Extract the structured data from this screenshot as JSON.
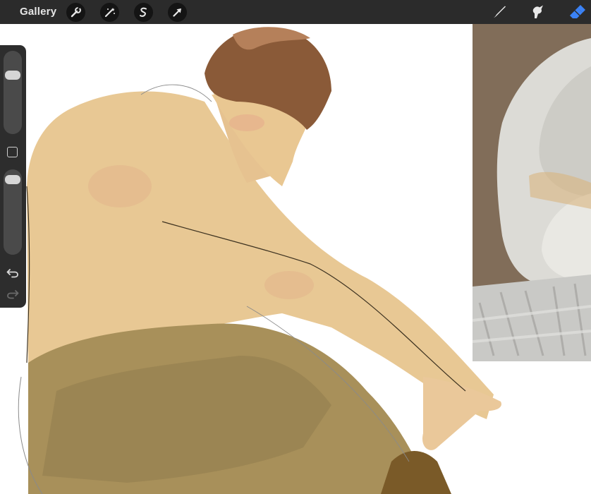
{
  "toolbar": {
    "gallery_label": "Gallery",
    "left_tools": [
      "wrench-icon",
      "magic-wand-icon",
      "selection-icon",
      "transform-arrow-icon"
    ],
    "right_tools": [
      "brush-icon",
      "smudge-icon",
      "eraser-icon"
    ],
    "active_tool": "eraser-icon"
  },
  "sidebar": {
    "brush_size_level": 0.25,
    "opacity_level": 0.05,
    "buttons": [
      "modify-button",
      "undo-icon",
      "redo-icon"
    ]
  },
  "colors": {
    "toolbar_bg": "#2b2b2b",
    "accent_active": "#3b82f6",
    "skin": "#e8c894",
    "pants": "#a8905a",
    "hair": "#8a5a38"
  }
}
